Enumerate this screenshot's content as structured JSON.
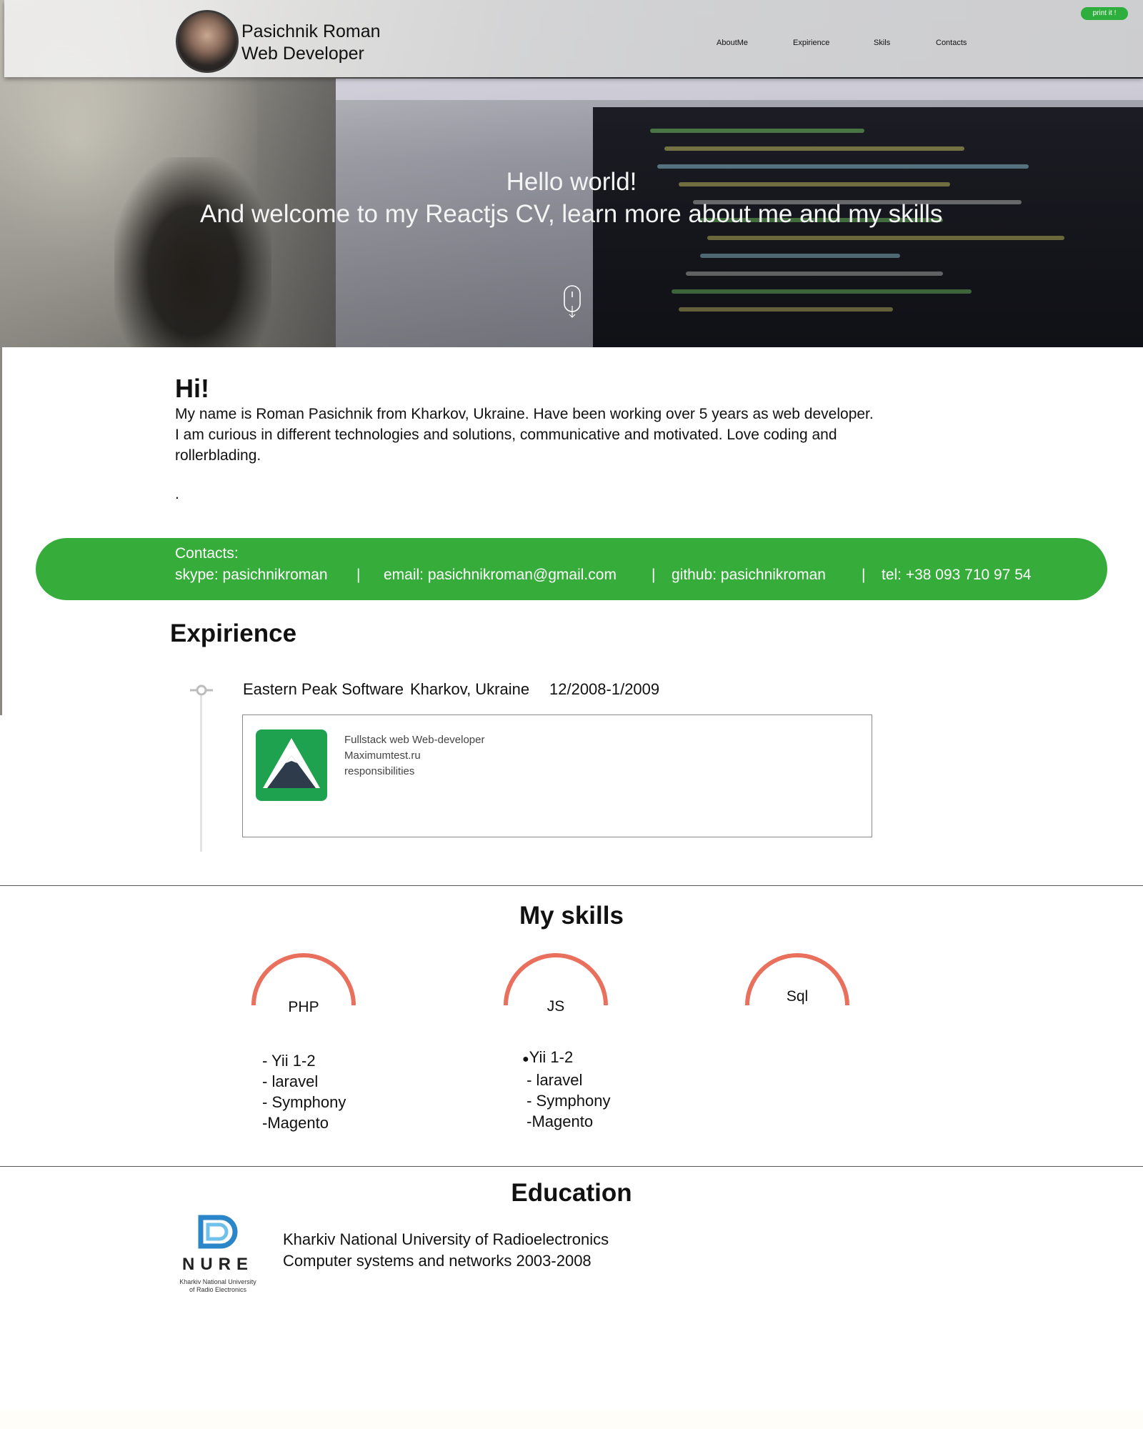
{
  "header": {
    "name": "Pasichnik Roman",
    "role": "Web Developer",
    "nav": [
      "AboutMe",
      "Expirience",
      "Skils",
      "Contacts"
    ],
    "print_label": "print it !"
  },
  "hero": {
    "title": "Hello world!",
    "subtitle": "And welcome to my Reactjs CV,  learn more about me and my skills",
    "scroll_icon": "mouse-scroll-icon"
  },
  "about": {
    "heading": "Hi!",
    "lines": [
      "My name is Roman Pasichnik from Kharkov, Ukraine. Have been working over 5 years as web developer.",
      "I am curious in different technologies and solutions, communicative and motivated. Love coding and",
      "rollerblading."
    ],
    "dot": "."
  },
  "contacts": {
    "title": "Contacts:",
    "skype": "skype: pasichnikroman",
    "email": "email: pasichnikroman@gmail.com",
    "github": "github: pasichnikroman",
    "tel": "tel: +38 093 710 97 54",
    "separator": "|",
    "color": "#36ad3a"
  },
  "experience": {
    "title": "Expirience",
    "items": [
      {
        "company": "Eastern Peak Software",
        "location": "Kharkov, Ukraine",
        "period": "12/2008-1/2009",
        "position": "Fullstack web Web-developer",
        "site": "Maximumtest.ru",
        "details": "responsibilities"
      }
    ]
  },
  "skills": {
    "title": "My skills",
    "gauge_color": "#e8705c",
    "items": [
      {
        "name": "PHP",
        "list": [
          "- Yii 1-2",
          "- laravel",
          "- Symphony",
          "-Magento"
        ]
      },
      {
        "name": "JS",
        "list": [
          "Yii 1-2",
          " - laravel",
          " - Symphony",
          " -Magento"
        ]
      },
      {
        "name": "Sql",
        "list": []
      }
    ]
  },
  "education": {
    "title": "Education",
    "logo_text": "NURE",
    "logo_caption_1": "Kharkiv National University",
    "logo_caption_2": "of Radio Electronics",
    "university": "Kharkiv National University of Radioelectronics",
    "specialty": "Computer systems and networks 2003-2008"
  }
}
